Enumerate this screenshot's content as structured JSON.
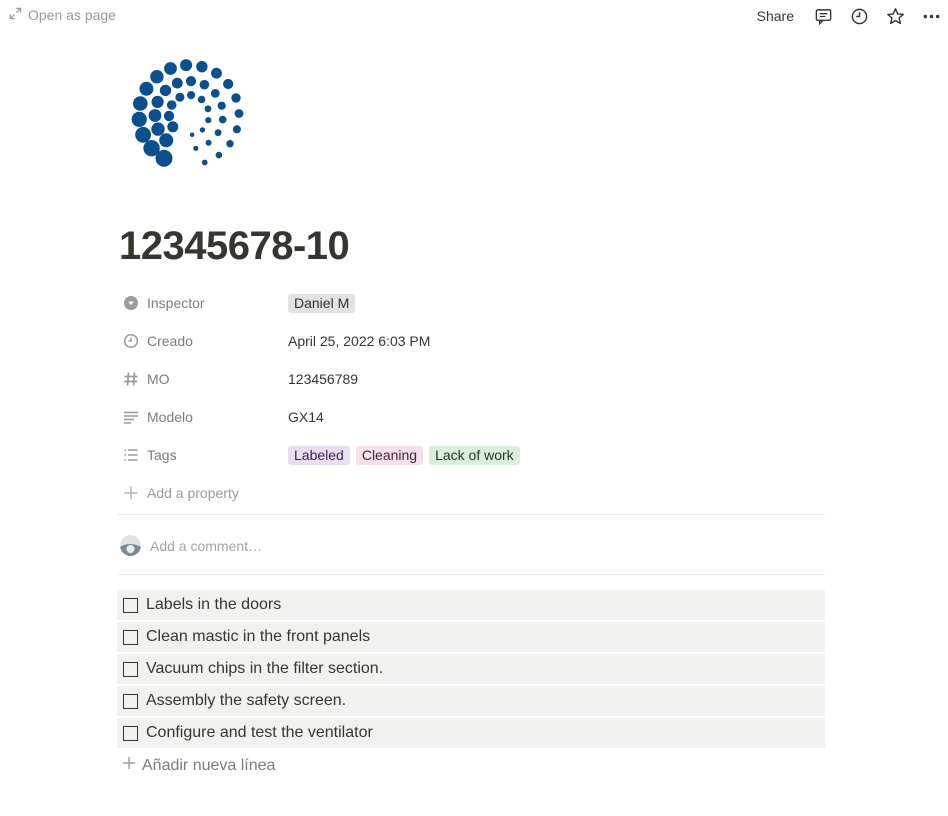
{
  "topbar": {
    "open_as_page": "Open as page",
    "share": "Share",
    "icons": [
      "expand-icon",
      "comment-icon",
      "clock-icon",
      "star-icon",
      "more-icon"
    ]
  },
  "page": {
    "icon": "dot-spiral-logo",
    "title": "12345678-10"
  },
  "properties": [
    {
      "icon": "person-icon",
      "name": "Inspector",
      "type": "person",
      "value": "Daniel M"
    },
    {
      "icon": "clock-icon",
      "name": "Creado",
      "type": "date",
      "value": "April 25, 2022 6:03 PM"
    },
    {
      "icon": "hash-icon",
      "name": "MO",
      "type": "number",
      "value": "123456789"
    },
    {
      "icon": "text-icon",
      "name": "Modelo",
      "type": "text",
      "value": "GX14"
    },
    {
      "icon": "list-icon",
      "name": "Tags",
      "type": "multi_select",
      "tags": [
        {
          "label": "Labeled",
          "color": "purple"
        },
        {
          "label": "Cleaning",
          "color": "pink"
        },
        {
          "label": "Lack of work",
          "color": "green"
        }
      ]
    }
  ],
  "add_property": "Add a property",
  "comment": {
    "placeholder": "Add a comment…"
  },
  "checklist": [
    {
      "label": "Labels in the doors",
      "checked": false
    },
    {
      "label": "Clean mastic in the front panels",
      "checked": false
    },
    {
      "label": "Vacuum chips in the filter section.",
      "checked": false
    },
    {
      "label": "Assembly the safety screen.",
      "checked": false
    },
    {
      "label": "Configure and test the ventilator",
      "checked": false
    }
  ],
  "add_line": "Añadir nueva línea",
  "colors": {
    "text": "#37352f",
    "muted": "#9b9a97",
    "logo": "#0b4f8c",
    "row_bg": "#f1f1ef"
  }
}
